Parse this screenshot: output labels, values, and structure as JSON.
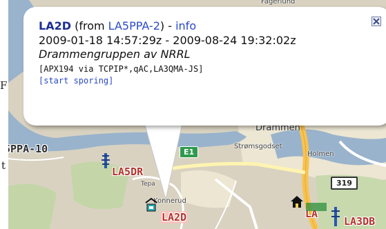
{
  "page": {
    "left_fragments": [
      "F",
      "t"
    ]
  },
  "map": {
    "place_labels": [
      "Drammen",
      "Strømsgodset",
      "Holmen",
      "Tepa",
      "Konnerud",
      "Fagerlund"
    ],
    "road_shields": [
      "E1",
      "319"
    ],
    "stations": [
      "5PPA-10",
      "LA5DR",
      "LA2D",
      "LA",
      "LA3DB"
    ]
  },
  "popup": {
    "callsign": "LA2D",
    "from_prefix": "(from ",
    "from_callsign": "LA5PPA-2",
    "from_suffix": ")",
    "separator": " - ",
    "info_link": "info",
    "time_range": "2009-01-18 14:57:29z - 2009-08-24 19:32:02z",
    "comment": "Drammengruppen av NRRL",
    "path": "[APX194 via TCPIP*,qAC,LA3QMA-JS]",
    "start_tracking": "[start sporing]",
    "close_icon": "close-icon"
  }
}
